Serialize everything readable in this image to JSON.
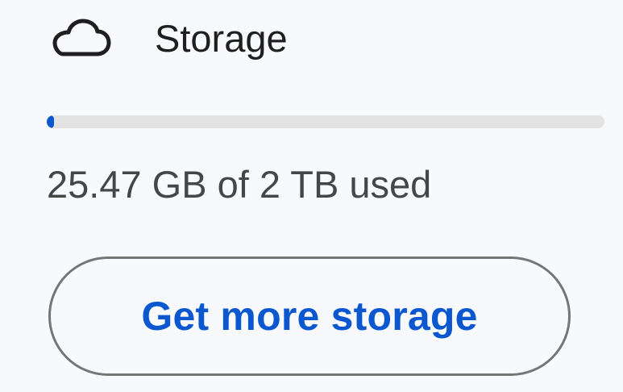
{
  "storage": {
    "icon": "cloud-icon",
    "title": "Storage",
    "usage_text": "25.47 GB of 2 TB used",
    "used_fraction": 0.0124,
    "button_label": "Get more storage"
  },
  "colors": {
    "accent": "#0b57d0",
    "track": "#e3e3e3",
    "background": "#f8f9fd",
    "button_border": "#747775",
    "secondary_text": "#444746"
  }
}
